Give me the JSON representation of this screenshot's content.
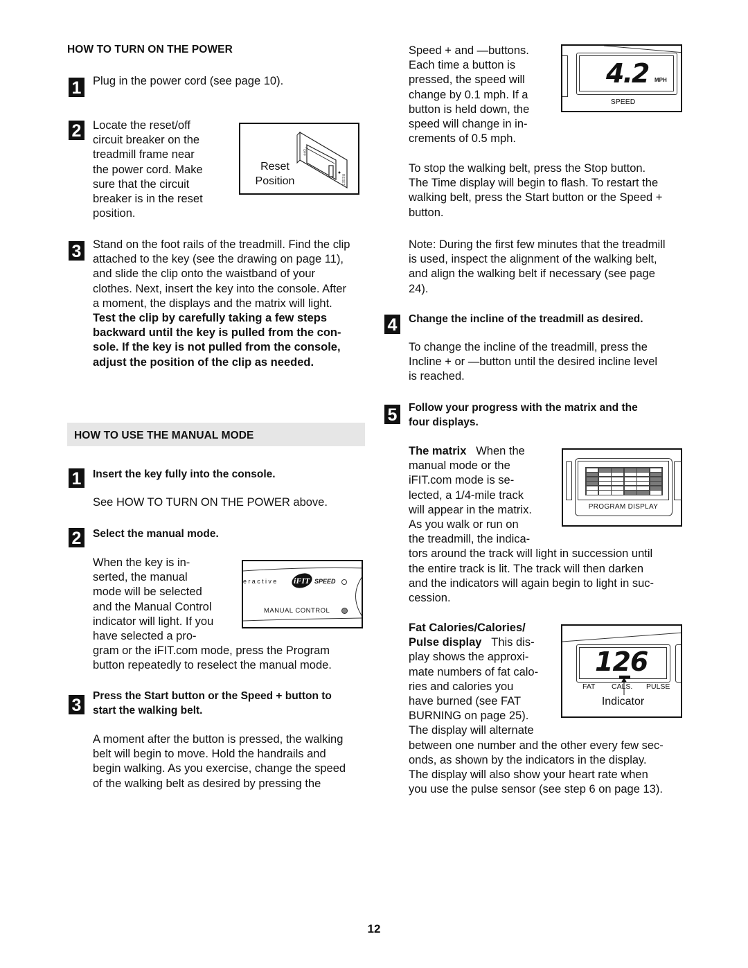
{
  "left": {
    "power_section": {
      "heading": "HOW TO TURN ON THE POWER",
      "steps": [
        {
          "number": "1",
          "text": "Plug in the power cord (see page 10)."
        },
        {
          "number": "2",
          "lines": [
            "Locate the reset/off",
            "circuit breaker on the",
            "treadmill frame near",
            "the power cord. Make",
            "sure that the circuit",
            "breaker is in the reset",
            "position."
          ]
        },
        {
          "number": "3",
          "lines": [
            "Stand on the foot rails of the treadmill. Find the clip",
            "attached to the key (see the drawing on page 11),",
            "and slide the clip onto the waistband of your",
            "clothes. Next, insert the key into the console. After",
            "a moment, the displays and the matrix will light."
          ],
          "bold_lines": [
            "Test the clip by carefully taking a few steps",
            "backward until the key is pulled from the con-",
            "sole. If the key is not pulled from the console,",
            "adjust the position of the clip as needed."
          ]
        }
      ],
      "breaker_figure": {
        "label_line1": "Reset",
        "label_line2": "Position",
        "switch_labels": [
          "OFF",
          "RESET"
        ]
      }
    },
    "manual_section": {
      "heading": "HOW TO USE THE MANUAL MODE",
      "steps": [
        {
          "number": "1",
          "title": "Insert the key fully into the console.",
          "text": "See HOW TO TURN ON THE POWER above."
        },
        {
          "number": "2",
          "title": "Select the manual mode.",
          "lines": [
            "When the key is in-",
            "serted, the manual",
            "mode will be selected",
            "and the Manual Control",
            "indicator will light. If you",
            "have selected a pro-",
            "gram or the iFIT.com mode, press the Program",
            "button repeatedly to reselect the manual mode."
          ]
        },
        {
          "number": "3",
          "title_lines": [
            "Press the Start button or the Speed + button to",
            "start the walking belt."
          ],
          "lines": [
            "A moment after the button is pressed, the walking",
            "belt will begin to move. Hold the handrails and",
            "begin walking. As you exercise, change the speed",
            "of the walking belt as desired by pressing the"
          ]
        }
      ],
      "console_figure": {
        "interactive_text": "eractive",
        "logo_text": "iFIT",
        "speed_text": "SPEED",
        "indicator_label": "MANUAL CONTROL"
      }
    }
  },
  "right": {
    "speed_lines": [
      "Speed + and —buttons.",
      "Each time a button is",
      "pressed, the speed will",
      "change by 0.1 mph. If a",
      "button is held down, the",
      "speed will change in in-",
      "crements of 0.5 mph."
    ],
    "speed_display": {
      "value": "4.2",
      "unit": "MPH",
      "label": "SPEED"
    },
    "stop_lines": [
      "To stop the walking belt, press the Stop button.",
      "The Time display will begin to flash. To restart the",
      "walking belt, press the Start button or the Speed +",
      "button."
    ],
    "note_lines": [
      "Note: During the first few minutes that the treadmill",
      "is used, inspect the alignment of the walking belt,",
      "and align the walking belt if necessary (see page",
      "24)."
    ],
    "step4": {
      "number": "4",
      "title": "Change the incline of the treadmill as desired.",
      "lines": [
        "To change the incline of the treadmill, press the",
        "Incline + or —button until the desired incline level",
        "is reached."
      ]
    },
    "step5": {
      "number": "5",
      "title_lines": [
        "Follow your progress with the matrix and the",
        "four displays."
      ]
    },
    "matrix": {
      "title": "The matrix",
      "lines_first": "When the",
      "lines": [
        "manual mode or the",
        "iFIT.com mode is se-",
        "lected, a 1/4-mile track",
        "will appear in the matrix.",
        "As you walk or run on",
        "the treadmill, the indica-",
        "tors around the track will light in succession until",
        "the entire track is lit. The track will then darken",
        "and the indicators will again begin to light in suc-",
        "cession."
      ],
      "display_label": "PROGRAM DISPLAY",
      "grid": [
        [
          0,
          1,
          1,
          1,
          1,
          0
        ],
        [
          1,
          0,
          0,
          0,
          0,
          1
        ],
        [
          1,
          0,
          0,
          0,
          0,
          1
        ],
        [
          1,
          0,
          0,
          0,
          0,
          1
        ],
        [
          0,
          0,
          0,
          0,
          0,
          1
        ],
        [
          0,
          0,
          0,
          1,
          1,
          0
        ]
      ]
    },
    "calories": {
      "title_line1": "Fat Calories/Calories/",
      "title_line2": "Pulse display",
      "title_tail": "This dis-",
      "lines": [
        "play shows the approxi-",
        "mate numbers of fat calo-",
        "ries and calories you",
        "have burned (see FAT",
        "BURNING on page 25).",
        "The display will alternate",
        "between one number and the other every few sec-",
        "onds, as shown by the indicators in the display.",
        "The display will also show your heart rate when",
        "you use the pulse sensor (see step 6 on page 13)."
      ],
      "display": {
        "value": "126",
        "labels": [
          "FAT",
          "CALS.",
          "PULSE"
        ],
        "indicator_label": "Indicator"
      }
    }
  },
  "page_number": "12"
}
